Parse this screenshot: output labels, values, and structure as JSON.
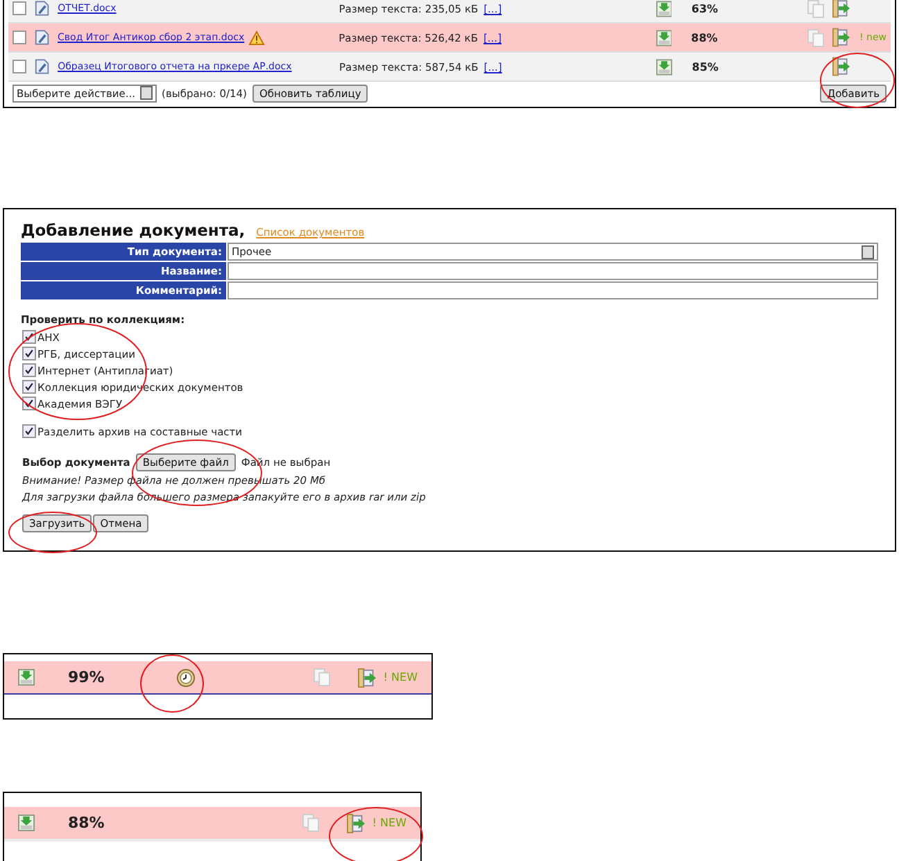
{
  "document_table": {
    "rows": [
      {
        "checked": false,
        "name": "ОТЧЕТ.docx",
        "warning": false,
        "size": "Размер текста: 235,05 кБ",
        "more": "[...]",
        "score": "63%",
        "highlighted": false,
        "copies": true,
        "new": false
      },
      {
        "checked": false,
        "name": "Свод Итог Антикор сбор 2 этап.docx",
        "warning": true,
        "size": "Размер текста: 526,42 кБ",
        "more": "[...]",
        "score": "88%",
        "highlighted": true,
        "copies": true,
        "new": true,
        "new_label": "! new"
      },
      {
        "checked": false,
        "name": "Образец Итогового отчета на пркере АР.docx",
        "warning": false,
        "size": "Размер текста: 587,54 кБ",
        "more": "[...]",
        "score": "85%",
        "highlighted": false,
        "copies": false,
        "new": false
      }
    ],
    "action_select": "Выберите действие...",
    "selected_count": "(выбрано: 0/14)",
    "refresh_button": "Обновить таблицу",
    "add_button": "Добавить"
  },
  "add_form": {
    "title": "Добавление документа,",
    "list_link": "Список документов",
    "fields": [
      {
        "label": "Тип документа:",
        "kind": "select",
        "value": "Прочее"
      },
      {
        "label": "Название:",
        "kind": "text"
      },
      {
        "label": "Комментарий:",
        "kind": "text"
      }
    ],
    "collections_heading": "Проверить по коллекциям:",
    "collections": [
      {
        "label": "АНХ",
        "checked": true
      },
      {
        "label": "РГБ, диссертации",
        "checked": true
      },
      {
        "label": "Интернет (Антиплагиат)",
        "checked": true
      },
      {
        "label": "Коллекция юридических документов",
        "checked": true
      },
      {
        "label": "Академия ВЭГУ",
        "checked": true
      }
    ],
    "split_archive": {
      "label": "Разделить архив на составные части",
      "checked": true
    },
    "file_label": "Выбор документа",
    "file_button": "Выберите файл",
    "file_status": "Файл не выбран",
    "notes": [
      "Внимание! Размер файла не должен превышать 20 Мб",
      "Для загрузки файла большего размера запакуйте его в архив rar или zip"
    ],
    "buttons": [
      "Загрузить",
      "Отмена"
    ]
  },
  "row_snippets": [
    {
      "score": "99%",
      "clock": true,
      "new": true,
      "new_label": "! NEW"
    },
    {
      "score": "88%",
      "clock": false,
      "new": true,
      "new_label": "! NEW"
    }
  ]
}
